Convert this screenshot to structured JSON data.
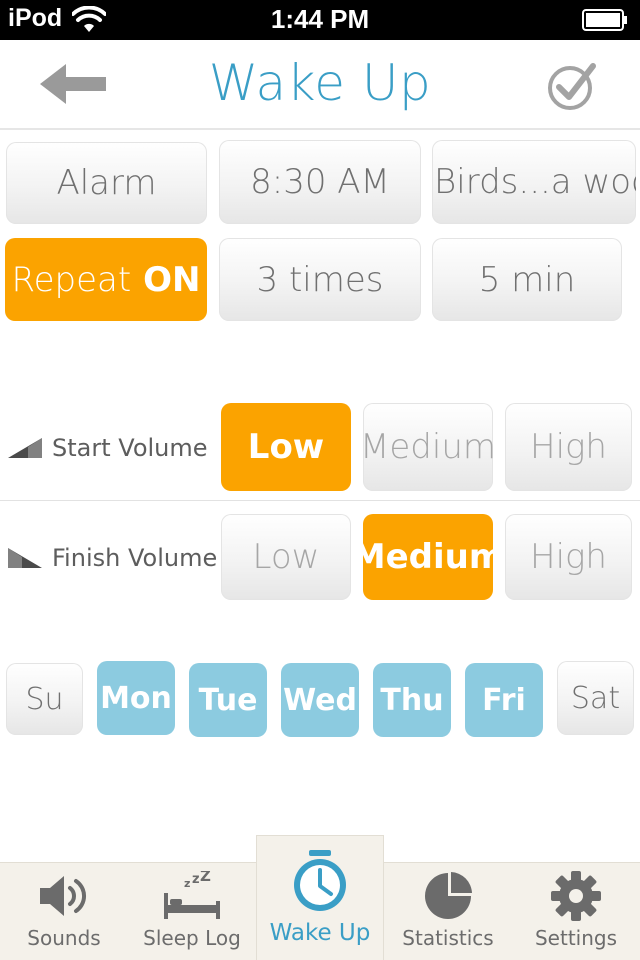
{
  "status_bar": {
    "carrier": "iPod",
    "time": "1:44 PM"
  },
  "nav": {
    "title": "Wake Up"
  },
  "alarm_row": {
    "alarm_label": "Alarm",
    "time": "8:30 AM",
    "sound": "Birds...a wood"
  },
  "repeat_row": {
    "repeat_label": "Repeat",
    "repeat_state": "ON",
    "times": "3 times",
    "interval": "5 min"
  },
  "start_volume": {
    "label": "Start Volume",
    "options": [
      "Low",
      "Medium",
      "High"
    ],
    "selected": "Low"
  },
  "finish_volume": {
    "label": "Finish Volume",
    "options": [
      "Low",
      "Medium",
      "High"
    ],
    "selected": "Medium"
  },
  "days": {
    "items": [
      "Su",
      "Mon",
      "Tue",
      "Wed",
      "Thu",
      "Fri",
      "Sat"
    ],
    "selected": [
      "Mon",
      "Tue",
      "Wed",
      "Thu",
      "Fri"
    ]
  },
  "tabs": [
    {
      "label": "Sounds",
      "icon": "speaker-icon"
    },
    {
      "label": "Sleep Log",
      "icon": "bed-icon"
    },
    {
      "label": "Wake Up",
      "icon": "clock-icon",
      "active": true
    },
    {
      "label": "Statistics",
      "icon": "pie-chart-icon"
    },
    {
      "label": "Settings",
      "icon": "gear-icon"
    }
  ],
  "colors": {
    "accent_blue": "#3a9ec6",
    "selected_orange": "#fba300",
    "day_blue": "#8ccbe0",
    "tabbar_bg": "#f4f1ea"
  }
}
